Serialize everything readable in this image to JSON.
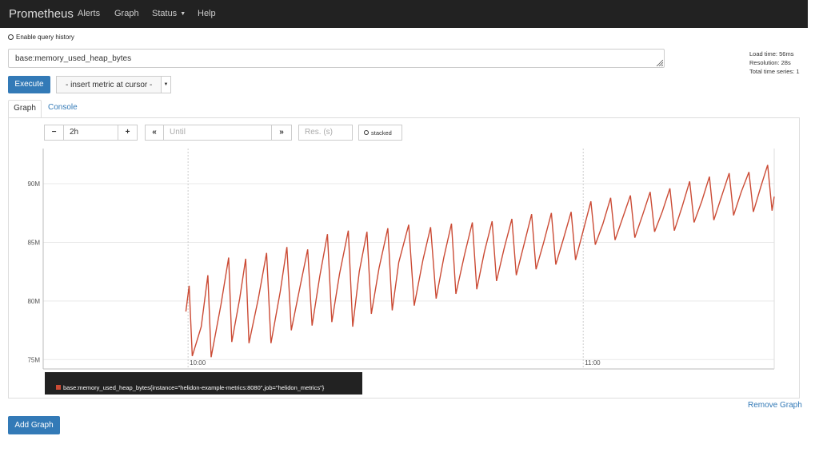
{
  "navbar": {
    "brand": "Prometheus",
    "links": [
      "Alerts",
      "Graph",
      "Status",
      "Help"
    ]
  },
  "query_history": {
    "label": "Enable query history",
    "enabled": false
  },
  "expression": {
    "value": "base:memory_used_heap_bytes"
  },
  "stats": {
    "load_time": "Load time: 56ms",
    "resolution": "Resolution: 28s",
    "total_series": "Total time series: 1"
  },
  "execute_label": "Execute",
  "metric_select": {
    "selected": "- insert metric at cursor -"
  },
  "tabs": [
    {
      "label": "Graph",
      "active": true
    },
    {
      "label": "Console",
      "active": false
    }
  ],
  "controls": {
    "minus": "−",
    "range": "2h",
    "plus": "+",
    "back": "«",
    "until_placeholder": "Until",
    "forward": "»",
    "res_placeholder": "Res. (s)",
    "stacked_label": "stacked"
  },
  "chart_data": {
    "type": "line",
    "x_ticks": [
      "10:00",
      "11:00"
    ],
    "y_ticks": [
      "75M",
      "80M",
      "85M",
      "90M"
    ],
    "ylim": [
      74200000,
      93000000
    ],
    "xlim": [
      "09:38",
      "11:29"
    ],
    "grid": true,
    "series": [
      {
        "name": "base:memory_used_heap_bytes{instance=\"helidon-example-metrics:8080\",job=\"helidon_metrics\"}",
        "color": "#cb4b35",
        "points": [
          [
            "09:59:40",
            79100000
          ],
          [
            "10:00:10",
            81300000
          ],
          [
            "10:00:38",
            75300000
          ],
          [
            "10:02:00",
            77800000
          ],
          [
            "10:03:00",
            82200000
          ],
          [
            "10:03:30",
            75200000
          ],
          [
            "10:05:00",
            79700000
          ],
          [
            "10:06:10",
            83700000
          ],
          [
            "10:06:38",
            76500000
          ],
          [
            "10:07:50",
            80200000
          ],
          [
            "10:08:45",
            83600000
          ],
          [
            "10:09:15",
            76400000
          ],
          [
            "10:10:40",
            80200000
          ],
          [
            "10:11:55",
            84100000
          ],
          [
            "10:12:35",
            76400000
          ],
          [
            "10:14:00",
            80800000
          ],
          [
            "10:15:00",
            84600000
          ],
          [
            "10:15:40",
            77500000
          ],
          [
            "10:17:00",
            81200000
          ],
          [
            "10:18:10",
            84400000
          ],
          [
            "10:18:50",
            77900000
          ],
          [
            "10:20:00",
            82100000
          ],
          [
            "10:21:10",
            85700000
          ],
          [
            "10:21:50",
            78200000
          ],
          [
            "10:23:00",
            82300000
          ],
          [
            "10:24:20",
            86000000
          ],
          [
            "10:25:00",
            77800000
          ],
          [
            "10:26:00",
            82500000
          ],
          [
            "10:27:10",
            85900000
          ],
          [
            "10:27:50",
            78900000
          ],
          [
            "10:29:00",
            82800000
          ],
          [
            "10:30:20",
            86200000
          ],
          [
            "10:31:00",
            79200000
          ],
          [
            "10:32:00",
            83300000
          ],
          [
            "10:33:30",
            86500000
          ],
          [
            "10:34:20",
            79600000
          ],
          [
            "10:35:40",
            83500000
          ],
          [
            "10:36:50",
            86300000
          ],
          [
            "10:37:40",
            80200000
          ],
          [
            "10:38:50",
            83700000
          ],
          [
            "10:40:00",
            86600000
          ],
          [
            "10:40:40",
            80600000
          ],
          [
            "10:42:00",
            84000000
          ],
          [
            "10:43:10",
            86700000
          ],
          [
            "10:43:50",
            81000000
          ],
          [
            "10:45:00",
            84200000
          ],
          [
            "10:46:10",
            86800000
          ],
          [
            "10:46:50",
            81700000
          ],
          [
            "10:48:00",
            84500000
          ],
          [
            "10:49:10",
            87000000
          ],
          [
            "10:49:50",
            82200000
          ],
          [
            "10:51:00",
            84800000
          ],
          [
            "10:52:10",
            87400000
          ],
          [
            "10:52:50",
            82700000
          ],
          [
            "10:54:00",
            85000000
          ],
          [
            "10:55:10",
            87500000
          ],
          [
            "10:55:50",
            83100000
          ],
          [
            "10:57:00",
            85300000
          ],
          [
            "10:58:10",
            87600000
          ],
          [
            "10:58:50",
            83500000
          ],
          [
            "11:00:00",
            86000000
          ],
          [
            "11:01:10",
            88500000
          ],
          [
            "11:01:50",
            84800000
          ],
          [
            "11:03:00",
            86600000
          ],
          [
            "11:04:10",
            88800000
          ],
          [
            "11:04:50",
            85200000
          ],
          [
            "11:06:00",
            87100000
          ],
          [
            "11:07:10",
            89000000
          ],
          [
            "11:07:50",
            85400000
          ],
          [
            "11:09:00",
            87300000
          ],
          [
            "11:10:10",
            89300000
          ],
          [
            "11:10:50",
            85900000
          ],
          [
            "11:12:00",
            87600000
          ],
          [
            "11:13:10",
            89600000
          ],
          [
            "11:13:50",
            86000000
          ],
          [
            "11:15:00",
            88000000
          ],
          [
            "11:16:10",
            90200000
          ],
          [
            "11:16:50",
            86700000
          ],
          [
            "11:18:00",
            88500000
          ],
          [
            "11:19:10",
            90600000
          ],
          [
            "11:19:50",
            86900000
          ],
          [
            "11:21:00",
            88900000
          ],
          [
            "11:22:10",
            90900000
          ],
          [
            "11:22:50",
            87300000
          ],
          [
            "11:24:00",
            89300000
          ],
          [
            "11:25:10",
            91000000
          ],
          [
            "11:25:50",
            87600000
          ],
          [
            "11:27:00",
            89800000
          ],
          [
            "11:28:00",
            91600000
          ],
          [
            "11:28:40",
            87700000
          ],
          [
            "11:29:00",
            88900000
          ]
        ]
      }
    ]
  },
  "legend": {
    "text": "base:memory_used_heap_bytes{instance=\"helidon-example-metrics:8080\",job=\"helidon_metrics\"}",
    "color": "#cb4b35"
  },
  "remove_graph_label": "Remove Graph",
  "add_graph_label": "Add Graph"
}
